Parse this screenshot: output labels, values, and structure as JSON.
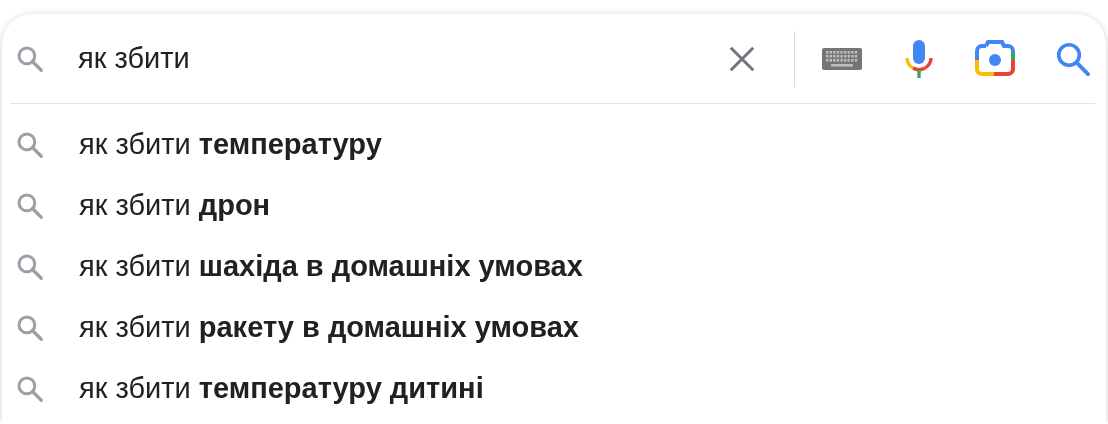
{
  "search": {
    "value": "як збити"
  },
  "suggestions": [
    {
      "text": "як збити **температуру**"
    },
    {
      "text": "як збити **дрон**"
    },
    {
      "text": "як збити **шахіда в домашніх умовах**"
    },
    {
      "text": "як збити **ракету в домашніх умовах**"
    },
    {
      "text": "як збити **температуру дитині**"
    }
  ]
}
